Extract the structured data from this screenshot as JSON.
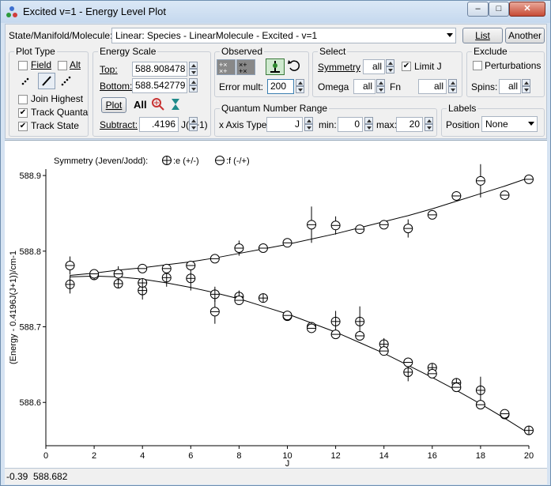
{
  "window": {
    "title": "Excited v=1 - Energy Level Plot",
    "minimize_glyph": "–",
    "maximize_glyph": "□",
    "close_glyph": "✕"
  },
  "header": {
    "label": "State/Manifold/Molecule:",
    "selected": "Linear: Species - LinearMolecule - Excited - v=1",
    "list_label": "List",
    "another_label": "Another"
  },
  "plot_type": {
    "title": "Plot Type",
    "field_label": "Field",
    "alt_label": "Alt",
    "join_highest_label": "Join Highest",
    "track_quanta_label": "Track Quanta",
    "track_state_label": "Track State",
    "field_checked": false,
    "alt_checked": false,
    "join_highest_checked": false,
    "track_quanta_checked": true,
    "track_state_checked": true
  },
  "energy_scale": {
    "title": "Energy Scale",
    "top_label": "Top:",
    "top_value": "588.908478",
    "bottom_label": "Bottom:",
    "bottom_value": "588.542779",
    "plot_label": "Plot",
    "all_label": "All",
    "subtract_label": "Subtract:",
    "subtract_value": ".4196",
    "subtract_unit": "J(J+1)"
  },
  "observed": {
    "title": "Observed",
    "error_mult_label": "Error mult:",
    "error_mult_value": "200"
  },
  "select": {
    "title": "Select",
    "symmetry_label": "Symmetry",
    "symmetry_value": "all",
    "limit_j_label": "Limit J",
    "limit_j_checked": true,
    "omega_label": "Omega",
    "omega_value": "all",
    "fn_label": "Fn",
    "fn_value": "all"
  },
  "exclude": {
    "title": "Exclude",
    "perturbations_label": "Perturbations",
    "perturbations_checked": false,
    "spins_label": "Spins:",
    "spins_value": "all"
  },
  "qn_range": {
    "title": "Quantum Number Range",
    "x_axis_type_label": "x Axis Type",
    "x_axis_type_value": "J",
    "min_label": "min:",
    "min_value": "0",
    "max_label": "max:",
    "max_value": "20"
  },
  "labels": {
    "title": "Labels",
    "position_label": "Position",
    "position_value": "None"
  },
  "status": {
    "x_value": "-0.39",
    "y_value": "588.682"
  },
  "chart_data": {
    "type": "scatter",
    "legend_title": "Symmetry (Jeven/Jodd):",
    "xlabel": "J",
    "ylabel": "(Energy - 0.4196J(J+1))/cm-1",
    "xlim": [
      0,
      20
    ],
    "ylim": [
      588.542779,
      588.908478
    ],
    "xticks": [
      0,
      2,
      4,
      6,
      8,
      10,
      12,
      14,
      16,
      18,
      20
    ],
    "yticks": [
      588.6,
      588.7,
      588.8,
      588.9
    ],
    "colors": {
      "mark": "#000000",
      "axis": "#000000"
    },
    "series": [
      {
        "name": ":e (+/-)",
        "marker": "circle-plus",
        "points": [
          {
            "x": 1,
            "y": 588.756,
            "err": 0.012
          },
          {
            "x": 2,
            "y": 588.768,
            "err": 0.004
          },
          {
            "x": 3,
            "y": 588.757,
            "err": 0.006
          },
          {
            "x": 4,
            "y": 588.748,
            "err": 0.012
          },
          {
            "x": 4,
            "y": 588.758,
            "err": 0.004
          },
          {
            "x": 5,
            "y": 588.765,
            "err": 0.012
          },
          {
            "x": 6,
            "y": 588.764,
            "err": 0.016
          },
          {
            "x": 7,
            "y": 588.743,
            "err": 0.01
          },
          {
            "x": 8,
            "y": 588.74,
            "err": 0.008
          },
          {
            "x": 9,
            "y": 588.738,
            "err": 0.006
          },
          {
            "x": 10,
            "y": 588.714,
            "err": 0.004
          },
          {
            "x": 11,
            "y": 588.7,
            "err": 0.004
          },
          {
            "x": 12,
            "y": 588.707,
            "err": 0.014
          },
          {
            "x": 13,
            "y": 588.707,
            "err": 0.02
          },
          {
            "x": 14,
            "y": 588.677,
            "err": 0.008
          },
          {
            "x": 15,
            "y": 588.64,
            "err": 0.012
          },
          {
            "x": 16,
            "y": 588.646,
            "err": 0.004
          },
          {
            "x": 17,
            "y": 588.626,
            "err": 0.004
          },
          {
            "x": 18,
            "y": 588.616,
            "err": 0.018
          },
          {
            "x": 19,
            "y": 588.584,
            "err": 0.004
          },
          {
            "x": 20,
            "y": 588.563,
            "err": 0.004
          }
        ]
      },
      {
        "name": ":f (-/+)",
        "marker": "circle-minus",
        "points": [
          {
            "x": 1,
            "y": 588.781,
            "err": 0.012
          },
          {
            "x": 2,
            "y": 588.77,
            "err": 0.004
          },
          {
            "x": 3,
            "y": 588.77,
            "err": 0.01
          },
          {
            "x": 4,
            "y": 588.777,
            "err": 0.004
          },
          {
            "x": 5,
            "y": 588.777,
            "err": 0.006
          },
          {
            "x": 6,
            "y": 588.781,
            "err": 0.004
          },
          {
            "x": 7,
            "y": 588.72,
            "err": 0.016
          },
          {
            "x": 7,
            "y": 588.79,
            "err": 0.004
          },
          {
            "x": 8,
            "y": 588.735,
            "err": 0.006
          },
          {
            "x": 8,
            "y": 588.804,
            "err": 0.01
          },
          {
            "x": 9,
            "y": 588.804,
            "err": 0.004
          },
          {
            "x": 10,
            "y": 588.715,
            "err": 0.004
          },
          {
            "x": 10,
            "y": 588.811,
            "err": 0.006
          },
          {
            "x": 11,
            "y": 588.698,
            "err": 0.004
          },
          {
            "x": 11,
            "y": 588.835,
            "err": 0.024
          },
          {
            "x": 12,
            "y": 588.69,
            "err": 0.006
          },
          {
            "x": 12,
            "y": 588.834,
            "err": 0.012
          },
          {
            "x": 13,
            "y": 588.688,
            "err": 0.004
          },
          {
            "x": 13,
            "y": 588.829,
            "err": 0.004
          },
          {
            "x": 14,
            "y": 588.668,
            "err": 0.004
          },
          {
            "x": 14,
            "y": 588.835,
            "err": 0.004
          },
          {
            "x": 15,
            "y": 588.653,
            "err": 0.006
          },
          {
            "x": 15,
            "y": 588.83,
            "err": 0.012
          },
          {
            "x": 16,
            "y": 588.638,
            "err": 0.004
          },
          {
            "x": 16,
            "y": 588.848,
            "err": 0.004
          },
          {
            "x": 17,
            "y": 588.62,
            "err": 0.006
          },
          {
            "x": 17,
            "y": 588.873,
            "err": 0.006
          },
          {
            "x": 18,
            "y": 588.597,
            "err": 0.006
          },
          {
            "x": 18,
            "y": 588.893,
            "err": 0.022
          },
          {
            "x": 19,
            "y": 588.585,
            "err": 0.004
          },
          {
            "x": 19,
            "y": 588.874,
            "err": 0.006
          },
          {
            "x": 20,
            "y": 588.895,
            "err": 0.006
          }
        ]
      }
    ],
    "curves": [
      {
        "name": "",
        "x": [
          1,
          2,
          3,
          4,
          5,
          6,
          7,
          8,
          9,
          10,
          11,
          12,
          13,
          14,
          15,
          16,
          17,
          18,
          19,
          20
        ],
        "y": [
          588.766,
          588.767,
          588.766,
          588.763,
          588.758,
          588.752,
          588.745,
          588.737,
          588.727,
          588.717,
          588.705,
          588.693,
          588.679,
          588.665,
          588.649,
          588.633,
          588.616,
          588.598,
          588.579,
          588.559
        ]
      },
      {
        "name": "",
        "x": [
          1,
          2,
          3,
          4,
          5,
          6,
          7,
          8,
          9,
          10,
          11,
          12,
          13,
          14,
          15,
          16,
          17,
          18,
          19,
          20
        ],
        "y": [
          588.768,
          588.771,
          588.775,
          588.778,
          588.782,
          588.786,
          588.791,
          588.797,
          588.803,
          588.809,
          588.816,
          588.823,
          588.831,
          588.839,
          588.847,
          588.856,
          588.866,
          588.876,
          588.886,
          588.897
        ]
      }
    ]
  }
}
